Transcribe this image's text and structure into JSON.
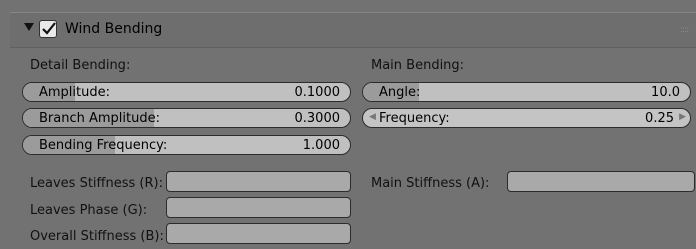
{
  "panel": {
    "title": "Wind Bending",
    "enabled": true
  },
  "detail": {
    "heading": "Detail Bending:",
    "fields": [
      {
        "label": "Amplitude:",
        "value": "0.1000",
        "fill_fraction": 0.16
      },
      {
        "label": "Branch Amplitude:",
        "value": "0.3000",
        "fill_fraction": 0.4
      },
      {
        "label": "Bending Frequency:",
        "value": "1.000",
        "fill_fraction": 0.28
      }
    ]
  },
  "main": {
    "heading": "Main Bending:",
    "fields": [
      {
        "label": "Angle:",
        "value": "10.0",
        "fill_fraction": 0.17
      },
      {
        "label": "Frequency:",
        "value": "0.25"
      }
    ]
  },
  "stiffness": {
    "leaves_stiffness": {
      "label": "Leaves Stiffness (R):",
      "value": ""
    },
    "leaves_phase": {
      "label": "Leaves Phase (G):",
      "value": ""
    },
    "overall_stiffness": {
      "label": "Overall Stiffness (B):",
      "value": ""
    },
    "main_stiffness": {
      "label": "Main Stiffness (A):",
      "value": ""
    }
  },
  "colors": {
    "background": "#727272",
    "field_bg": "#c0c0c0",
    "field_fill": "#9b9b9b",
    "textbox_bg": "#a9a9a9"
  }
}
